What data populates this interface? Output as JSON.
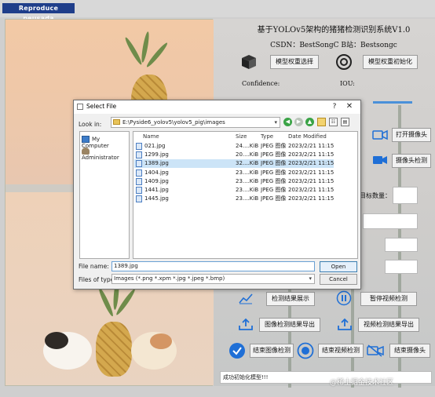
{
  "app": {
    "logo_text": "Reproduce peusada",
    "window_caption": "",
    "title": "基于YOLOv5架构的猪猪检测识别系统V1.0",
    "credits": "CSDN：BestSongC   B站：Bestsongc"
  },
  "controls": {
    "select_weights": "模型权重选择",
    "init_weights": "模型权重初始化",
    "confidence_label": "Confidence:",
    "iou_label": "IOU:",
    "open_camera": "打开摄像头",
    "camera_detect": "摄像头检测",
    "target_count_label": "目标数量：",
    "show_results": "检测结果展示",
    "pause_video": "暂停视频检测",
    "export_image_results": "图像检测结果导出",
    "export_video_results": "视频检测结果导出",
    "end_image_detect": "结束图像检测",
    "end_video_detect": "结束视频检测",
    "end_camera": "结束摄像头",
    "status_text": "成功初始化模型!!!",
    "watermark": "@稀土掘金技术社区"
  },
  "dialog": {
    "title": "Select File",
    "look_in_label": "Look in:",
    "look_in_path": "E:\\Pyside6_yolov5\\yolov5_pig\\images",
    "places": [
      "My Computer",
      "Administrator"
    ],
    "columns": [
      "Name",
      "Size",
      "Type",
      "Date Modified"
    ],
    "files": [
      {
        "name": "021.jpg",
        "size": "24....KiB",
        "type": "JPEG 图像",
        "date": "2023/2/21 11:15",
        "selected": false
      },
      {
        "name": "1299.jpg",
        "size": "20....KiB",
        "type": "JPEG 图像",
        "date": "2023/2/21 11:15",
        "selected": false
      },
      {
        "name": "1389.jpg",
        "size": "32....KiB",
        "type": "JPEG 图像",
        "date": "2023/2/21 11:15",
        "selected": true
      },
      {
        "name": "1404.jpg",
        "size": "23....KiB",
        "type": "JPEG 图像",
        "date": "2023/2/21 11:15",
        "selected": false
      },
      {
        "name": "1409.jpg",
        "size": "23....KiB",
        "type": "JPEG 图像",
        "date": "2023/2/21 11:15",
        "selected": false
      },
      {
        "name": "1441.jpg",
        "size": "23....KiB",
        "type": "JPEG 图像",
        "date": "2023/2/21 11:15",
        "selected": false
      },
      {
        "name": "1445.jpg",
        "size": "23....KiB",
        "type": "JPEG 图像",
        "date": "2023/2/21 11:15",
        "selected": false
      }
    ],
    "file_name_label": "File name:",
    "file_name_value": "1389.jpg",
    "files_of_type_label": "Files of type:",
    "files_of_type_value": "Images (*.png *.xpm *.jpg *.jpeg *.bmp)",
    "open_label": "Open",
    "cancel_label": "Cancel",
    "help_glyph": "?",
    "close_glyph": "✕"
  },
  "icons": {
    "cube": "cube-icon",
    "gear": "gear-icon",
    "video": "video-camera-icon",
    "chart": "chart-icon",
    "pause": "pause-icon",
    "upload": "upload-icon",
    "check": "check-circle-icon",
    "stop": "stop-circle-icon",
    "camera_off": "camera-off-icon"
  }
}
